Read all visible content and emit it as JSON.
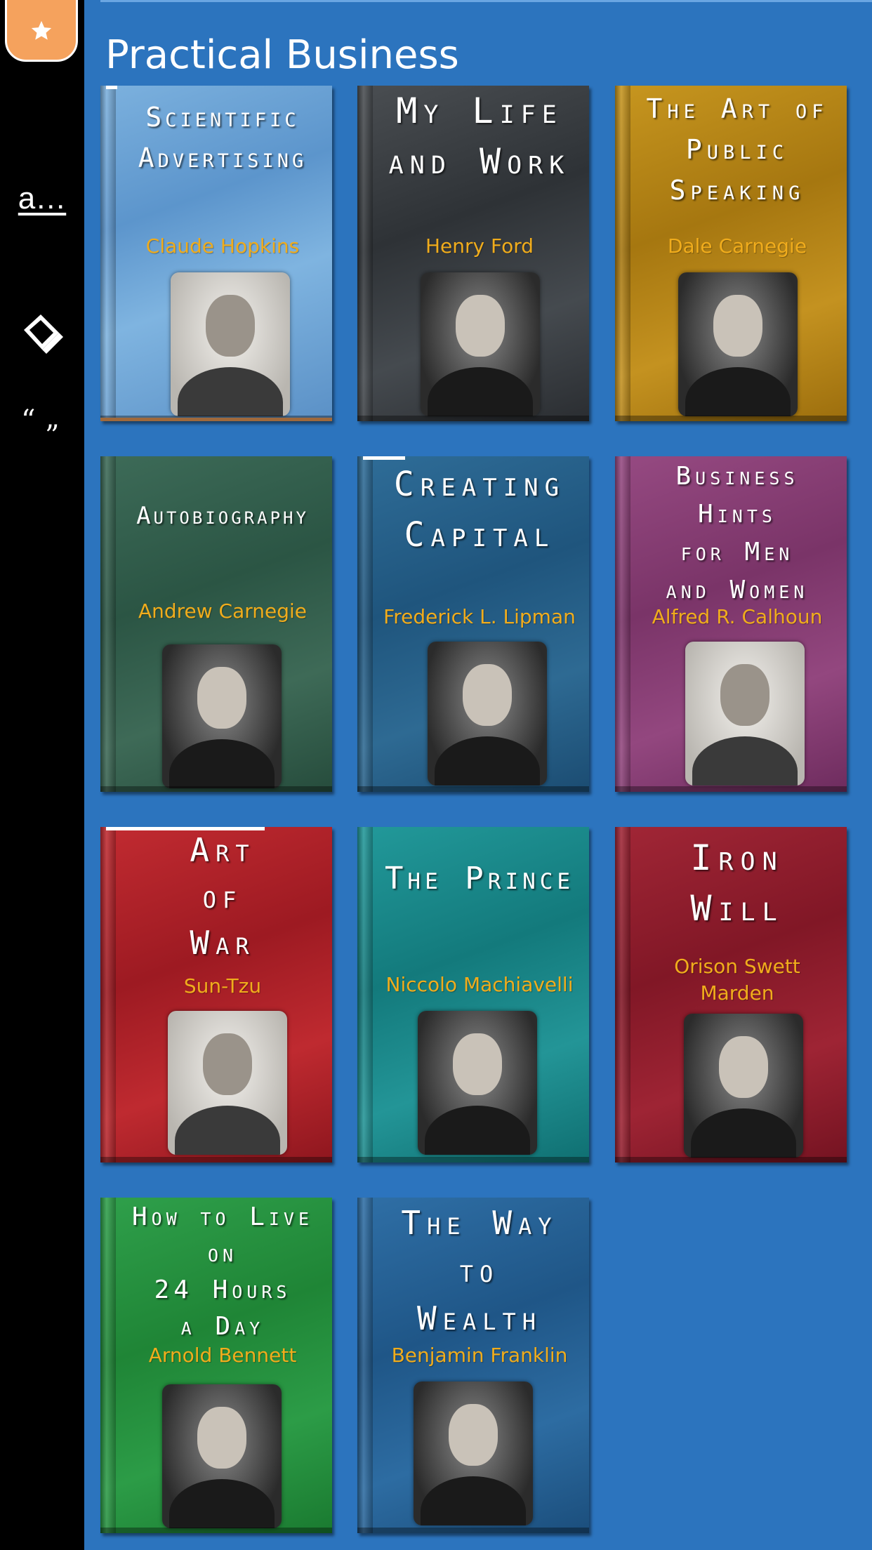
{
  "sidebar": {
    "favorite_icon": "star-icon",
    "text": "a…",
    "tag_icon": "tag-icon",
    "quote_icon": "quote-icon",
    "quote_open": "“",
    "quote_close": "”"
  },
  "section": {
    "title": "Practical Business"
  },
  "colors": {
    "background": "#2c74be",
    "sidebar": "#000000",
    "accent": "#f5a25d",
    "author_text": "#f0ac1c"
  },
  "books": [
    {
      "title": "Scientific\nAdvertising",
      "author": "Claude Hopkins"
    },
    {
      "title": "My Life\nand Work",
      "author": "Henry Ford"
    },
    {
      "title": "The Art of\nPublic\nSpeaking",
      "author": "Dale Carnegie"
    },
    {
      "title": "Autobiography",
      "author": "Andrew Carnegie"
    },
    {
      "title": "Creating\nCapital",
      "author": "Frederick L. Lipman"
    },
    {
      "title": "Business\nHints\nfor Men\nand Women",
      "author": "Alfred R. Calhoun"
    },
    {
      "title": "Art\nof\nWar",
      "author": "Sun-Tzu"
    },
    {
      "title": "The Prince",
      "author": "Niccolo Machiavelli"
    },
    {
      "title": "Iron\nWill",
      "author": "Orison Swett\nMarden"
    },
    {
      "title": "How to Live\non\n24 Hours\na Day",
      "author": "Arnold Bennett"
    },
    {
      "title": "The Way\nto\nWealth",
      "author": "Benjamin Franklin"
    }
  ]
}
